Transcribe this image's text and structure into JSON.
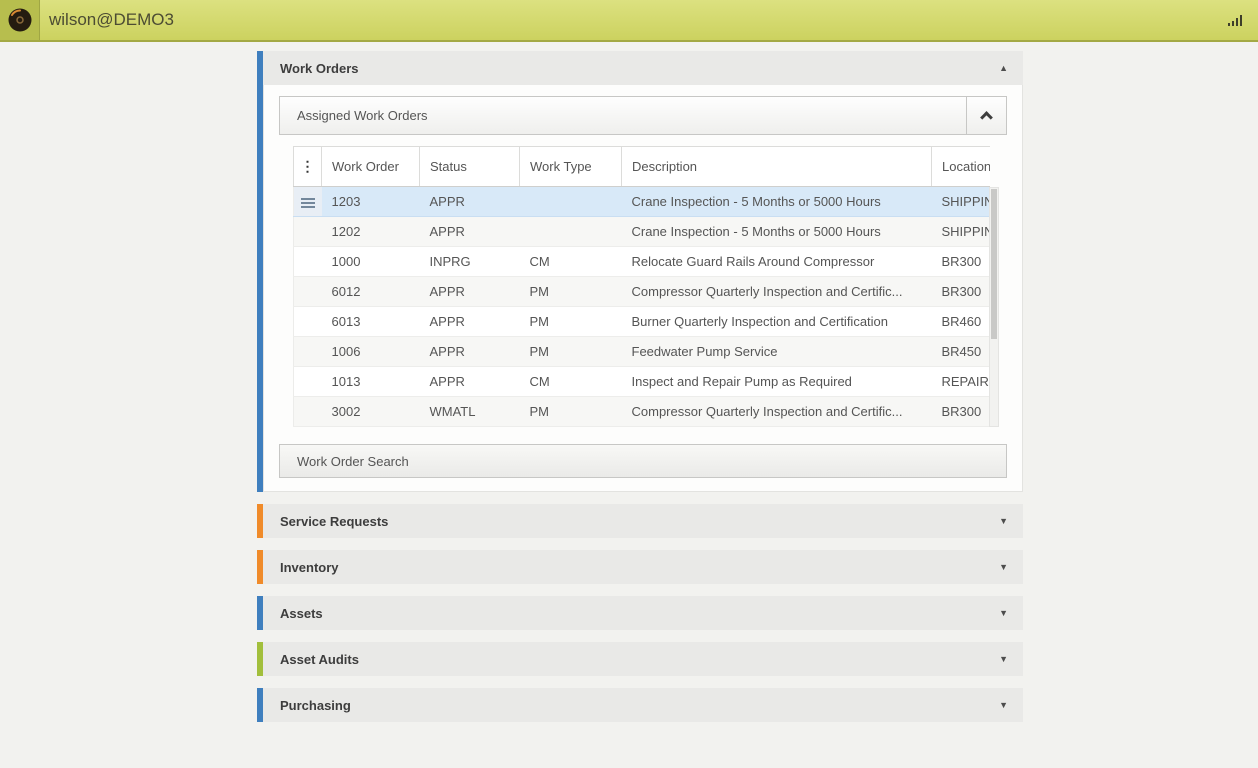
{
  "topbar": {
    "title": "wilson@DEMO3"
  },
  "icons": {
    "collapse_triangle": "▲",
    "expand_triangle": "▼",
    "overflow_dots": "⋮"
  },
  "work_orders": {
    "title": "Work Orders",
    "accent_color": "#3f7fbe",
    "assigned_title": "Assigned Work Orders",
    "search_label": "Work Order Search",
    "table": {
      "columns": [
        "Work Order",
        "Status",
        "Work Type",
        "Description",
        "Location"
      ],
      "rows": [
        {
          "wo": "1203",
          "status": "APPR",
          "type": "",
          "desc": "Crane Inspection - 5 Months or 5000 Hours",
          "loc": "SHIPPING",
          "selected": true
        },
        {
          "wo": "1202",
          "status": "APPR",
          "type": "",
          "desc": "Crane Inspection - 5 Months or 5000 Hours",
          "loc": "SHIPPING"
        },
        {
          "wo": "1000",
          "status": "INPRG",
          "type": "CM",
          "desc": "Relocate Guard Rails Around Compressor",
          "loc": "BR300"
        },
        {
          "wo": "6012",
          "status": "APPR",
          "type": "PM",
          "desc": "Compressor Quarterly Inspection and Certific...",
          "loc": "BR300"
        },
        {
          "wo": "6013",
          "status": "APPR",
          "type": "PM",
          "desc": "Burner Quarterly Inspection and Certification",
          "loc": "BR460"
        },
        {
          "wo": "1006",
          "status": "APPR",
          "type": "PM",
          "desc": "Feedwater Pump Service",
          "loc": "BR450"
        },
        {
          "wo": "1013",
          "status": "APPR",
          "type": "CM",
          "desc": "Inspect and Repair Pump as Required",
          "loc": "REPAIR"
        },
        {
          "wo": "3002",
          "status": "WMATL",
          "type": "PM",
          "desc": "Compressor Quarterly Inspection and Certific...",
          "loc": "BR300"
        }
      ]
    }
  },
  "collapsed_panels": [
    {
      "title": "Service Requests",
      "accent_color": "#f08b2a"
    },
    {
      "title": "Inventory",
      "accent_color": "#f08b2a"
    },
    {
      "title": "Assets",
      "accent_color": "#3f7fbe"
    },
    {
      "title": "Asset Audits",
      "accent_color": "#a2bf3c"
    },
    {
      "title": "Purchasing",
      "accent_color": "#3f7fbe"
    }
  ]
}
